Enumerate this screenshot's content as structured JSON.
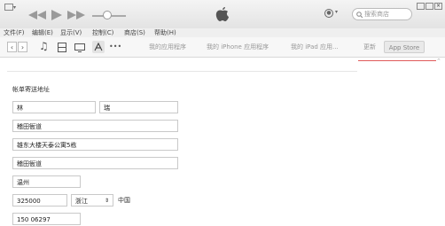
{
  "menu": {
    "file": "文件(F)",
    "edit": "编辑(E)",
    "view": "显示(V)",
    "controls": "控制(C)",
    "store": "商店(S)",
    "help": "帮助(H)"
  },
  "titlebar": {
    "search_placeholder": "搜索商店",
    "icons": [
      "rewind-icon",
      "play-icon",
      "fast-forward-icon",
      "volume-slider",
      "apple-logo-icon",
      "account-icon",
      "search-icon",
      "minimize-icon",
      "maximize-icon",
      "close-icon"
    ]
  },
  "toolbar": {
    "tabs": [
      "我的应用程序",
      "我的 iPhone 应用程序",
      "我的 iPad 应用...",
      "更新"
    ],
    "app_store_button": "App Store",
    "more": "•••"
  },
  "form": {
    "section_title": "帐单寄送地址",
    "last_name": "林",
    "first_name": "瑞",
    "street1": "稽田衙道",
    "street2": "雄东大楼天泰公寓5栋",
    "street3": "稽田衙道",
    "city": "温州",
    "postcode": "325000",
    "province": "浙江",
    "country": "中国",
    "phone": "150     06297"
  },
  "colors": {
    "accent": "#e05a5a"
  }
}
